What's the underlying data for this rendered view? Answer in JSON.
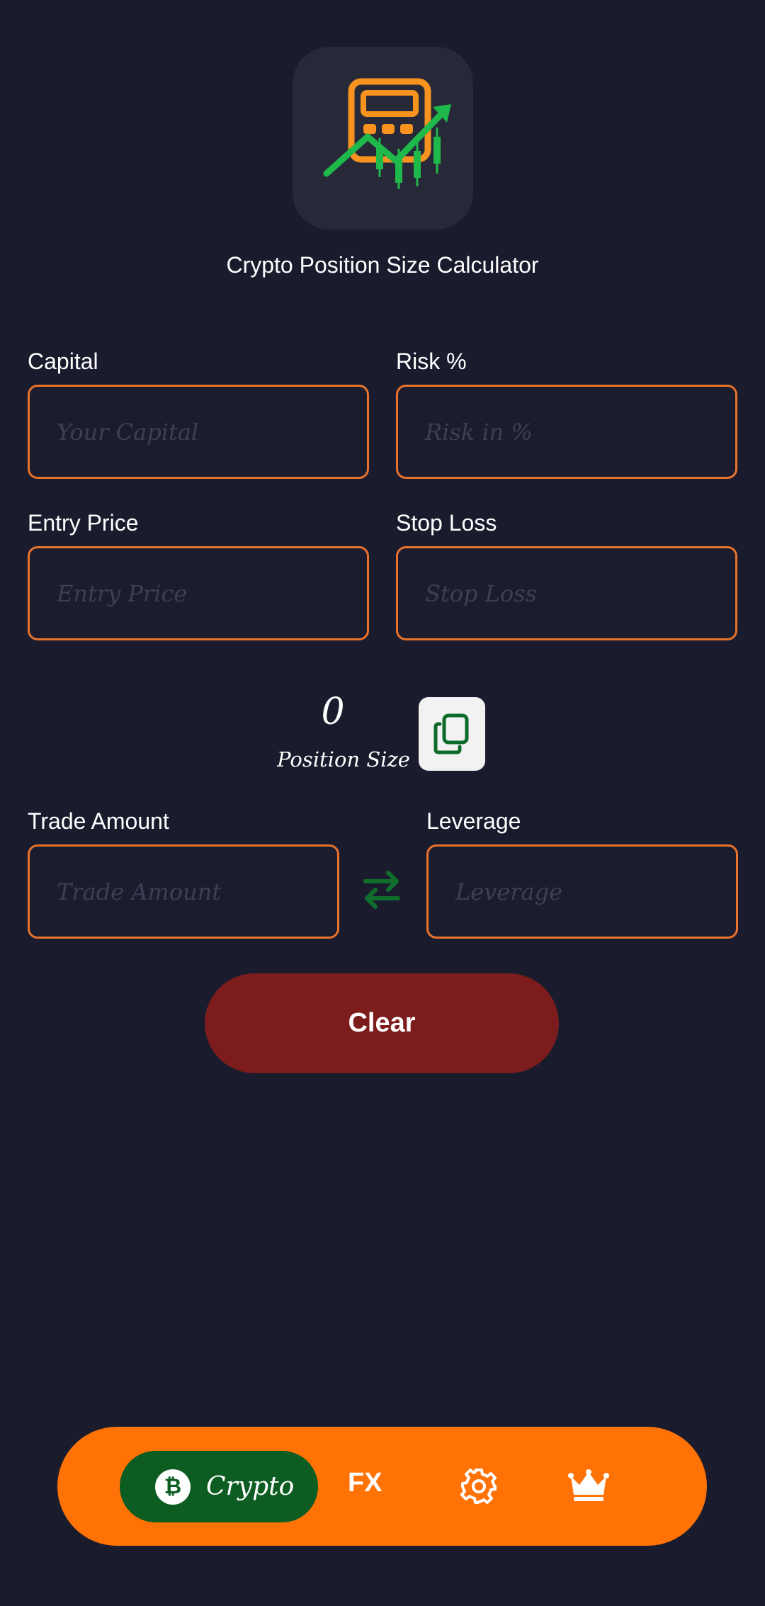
{
  "app": {
    "title": "Crypto Position Size Calculator",
    "icon": "calculator-chart-icon"
  },
  "form": {
    "capital": {
      "label": "Capital",
      "placeholder": "Your Capital",
      "value": ""
    },
    "risk": {
      "label": "Risk %",
      "placeholder": "Risk in %",
      "value": ""
    },
    "entry_price": {
      "label": "Entry Price",
      "placeholder": "Entry Price",
      "value": ""
    },
    "stop_loss": {
      "label": "Stop Loss",
      "placeholder": "Stop Loss",
      "value": ""
    }
  },
  "result": {
    "value": "0",
    "label": "Position Size",
    "copy_icon": "copy-icon"
  },
  "conversion": {
    "trade_amount": {
      "label": "Trade Amount",
      "placeholder": "Trade Amount",
      "value": ""
    },
    "leverage": {
      "label": "Leverage",
      "placeholder": "Leverage",
      "value": ""
    },
    "swap_icon": "swap-arrows-icon"
  },
  "actions": {
    "clear_label": "Clear"
  },
  "bottom_nav": {
    "crypto_label": "Crypto",
    "crypto_badge": "₿",
    "fx_label": "FX",
    "settings_icon": "gear-icon",
    "premium_icon": "crown-icon",
    "active": "Crypto"
  },
  "colors": {
    "background": "#1a1c2e",
    "input_border": "#e8722a",
    "clear_button": "#7c1c1c",
    "nav_background": "#ff7205",
    "nav_active": "#0d5d22",
    "icon_green": "#1fb84a",
    "icon_orange": "#f7931e"
  }
}
